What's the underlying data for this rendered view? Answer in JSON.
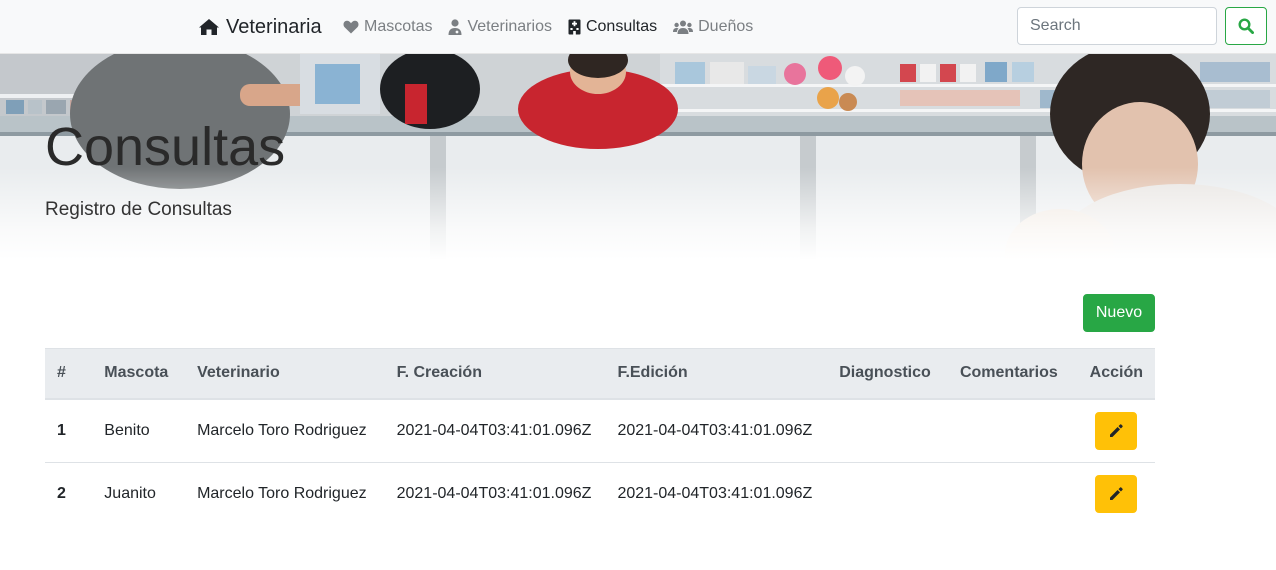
{
  "navbar": {
    "brand": {
      "label": "Veterinaria",
      "icon": "home-icon"
    },
    "links": [
      {
        "label": "Mascotas",
        "icon": "heart-icon",
        "active": false
      },
      {
        "label": "Veterinarios",
        "icon": "user-doctor-icon",
        "active": false
      },
      {
        "label": "Consultas",
        "icon": "hospital-icon",
        "active": true
      },
      {
        "label": "Dueños",
        "icon": "users-icon",
        "active": false
      }
    ],
    "search": {
      "placeholder": "Search",
      "value": "",
      "button_icon": "search-icon"
    }
  },
  "hero": {
    "title": "Consultas",
    "subtitle": "Registro de Consultas"
  },
  "toolbar": {
    "new_label": "Nuevo"
  },
  "table": {
    "headers": [
      "#",
      "Mascota",
      "Veterinario",
      "F. Creación",
      "F.Edición",
      "Diagnostico",
      "Comentarios",
      "Acción"
    ],
    "rows": [
      {
        "num": "1",
        "mascota": "Benito",
        "veterinario": "Marcelo Toro Rodriguez",
        "creacion": "2021-04-04T03:41:01.096Z",
        "edicion": "2021-04-04T03:41:01.096Z",
        "diagnostico": "",
        "comentarios": "",
        "action_icon": "pencil-icon"
      },
      {
        "num": "2",
        "mascota": "Juanito",
        "veterinario": "Marcelo Toro Rodriguez",
        "creacion": "2021-04-04T03:41:01.096Z",
        "edicion": "2021-04-04T03:41:01.096Z",
        "diagnostico": "",
        "comentarios": "",
        "action_icon": "pencil-icon"
      }
    ]
  },
  "colors": {
    "success": "#28a745",
    "warning": "#ffc107",
    "navbar_bg": "#f8f9fa",
    "table_head_bg": "#e9ecef"
  }
}
